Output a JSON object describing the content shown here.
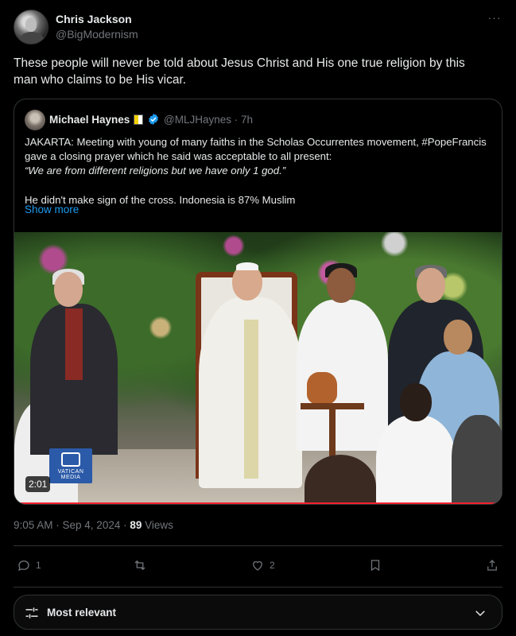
{
  "tweet": {
    "author_name": "Chris Jackson",
    "author_handle": "@BigModernism",
    "more_icon": "more-horizontal-icon",
    "text": "These people will never be told about Jesus Christ and His one true religion by this man who claims to be His vicar.",
    "timestamp": "9:05 AM · Sep 4, 2024",
    "views_count": "89",
    "views_label": "Views"
  },
  "quoted": {
    "author_name": "Michael Haynes",
    "author_handle": "@MLJHaynes · 7h",
    "verified_color": "#1d9bf0",
    "flag_colors": [
      "#f4d000",
      "#ffffff"
    ],
    "body_line1": "JAKARTA: Meeting with young of many faiths in the Scholas Occurrentes movement, #PopeFrancis gave a closing prayer which he said was acceptable to all present:",
    "body_quote": "“We are from different religions but we have only 1 god.”",
    "body_line2": "He didn't make sign of the cross. Indonesia is 87% Muslim",
    "show_more": "Show more",
    "video": {
      "duration": "2:01",
      "logo_text": "VATICAN MEDIA",
      "progress": 1.0,
      "progress_color": "#f4212e"
    }
  },
  "actions": {
    "reply_count": "1",
    "retweet_count": "",
    "like_count": "2",
    "icons": [
      "reply-icon",
      "retweet-icon",
      "like-icon",
      "bookmark-icon",
      "share-icon"
    ]
  },
  "sort": {
    "label": "Most relevant",
    "icon": "sliders-icon",
    "chevron": "chevron-down-icon"
  },
  "colors": {
    "background": "#000000",
    "text_primary": "#e7e9ea",
    "text_secondary": "#71767b",
    "link": "#1d9bf0",
    "border": "#2f3336"
  }
}
